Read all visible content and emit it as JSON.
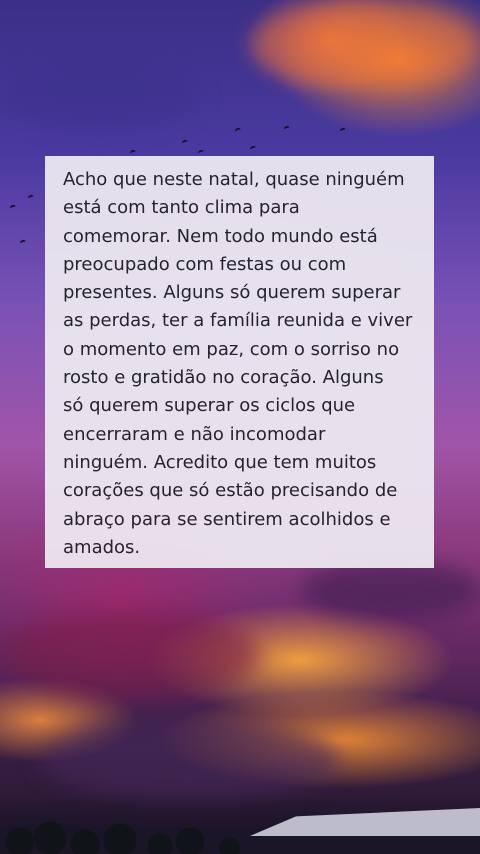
{
  "quote": {
    "text": "Acho que neste natal, quase ninguém\nestá com tanto clima para\ncomemorar. Nem todo mundo está\npreocupado com festas ou com\npresentes. Alguns só querem superar\nas perdas, ter a família reunida e viver\no momento em paz, com o sorriso no\nrosto e gratidão no coração. Alguns\nsó querem superar os ciclos que\nencerraram e não incomodar\nninguém. Acredito que tem muitos\ncorações que só estão precisando de\nabraço para se sentirem acolhidos e\namados."
  },
  "colors": {
    "card_background": "#ece8f0",
    "text": "#26222e",
    "sky_top": "#3a2f86",
    "sky_middle": "#a055a8",
    "glow_orange": "#ffa03c"
  }
}
